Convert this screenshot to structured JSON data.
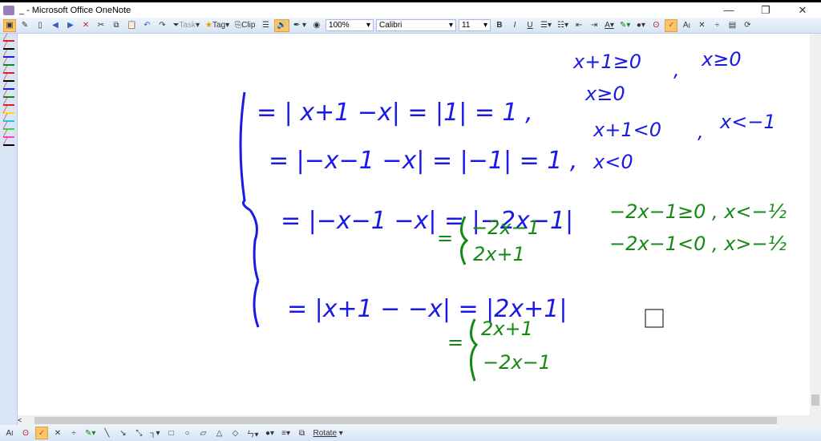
{
  "window": {
    "title": "_ - Microsoft Office OneNote",
    "minimize": "—",
    "restore": "❐",
    "close": "✕"
  },
  "toolbar": {
    "task": "Task",
    "tag": "Tag",
    "clip": "Clip",
    "zoom": "100%",
    "font": "Calibri",
    "size": "11",
    "bold": "B",
    "italic": "I",
    "underline": "U"
  },
  "bottombar": {
    "rotate": "Rotate"
  },
  "pens": [
    "#e02020",
    "#000000",
    "#1a1ae6",
    "#148a14",
    "#e02020",
    "#000000",
    "#1a1ae6",
    "#148a14",
    "#e02020",
    "#ffe000",
    "#20c0f0",
    "#40d040",
    "#ff40c0",
    "#000000"
  ],
  "colors": {
    "blue": "#1a1ae6",
    "green": "#148a14"
  },
  "notes": {
    "blue_lines": [
      "= | x+1 −x| = |1| = 1 ,",
      "= |−x−1 −x| = |−1| = 1 ,",
      "= |−x−1 −x| = |−2x−1|",
      "= |x+1 − −x| = |2x+1|"
    ],
    "green_case1": [
      "=",
      "−2x−1",
      "2x+1"
    ],
    "green_case2": [
      "=",
      "2x+1",
      "−2x−1"
    ],
    "blue_conditions": [
      "x+1≥0",
      "x≥0",
      "x≥0",
      "x+1<0",
      "x<−1",
      "x<0"
    ],
    "green_conditions": [
      "−2x−1≥0 , x<−½",
      "−2x−1<0 , x>−½"
    ]
  }
}
